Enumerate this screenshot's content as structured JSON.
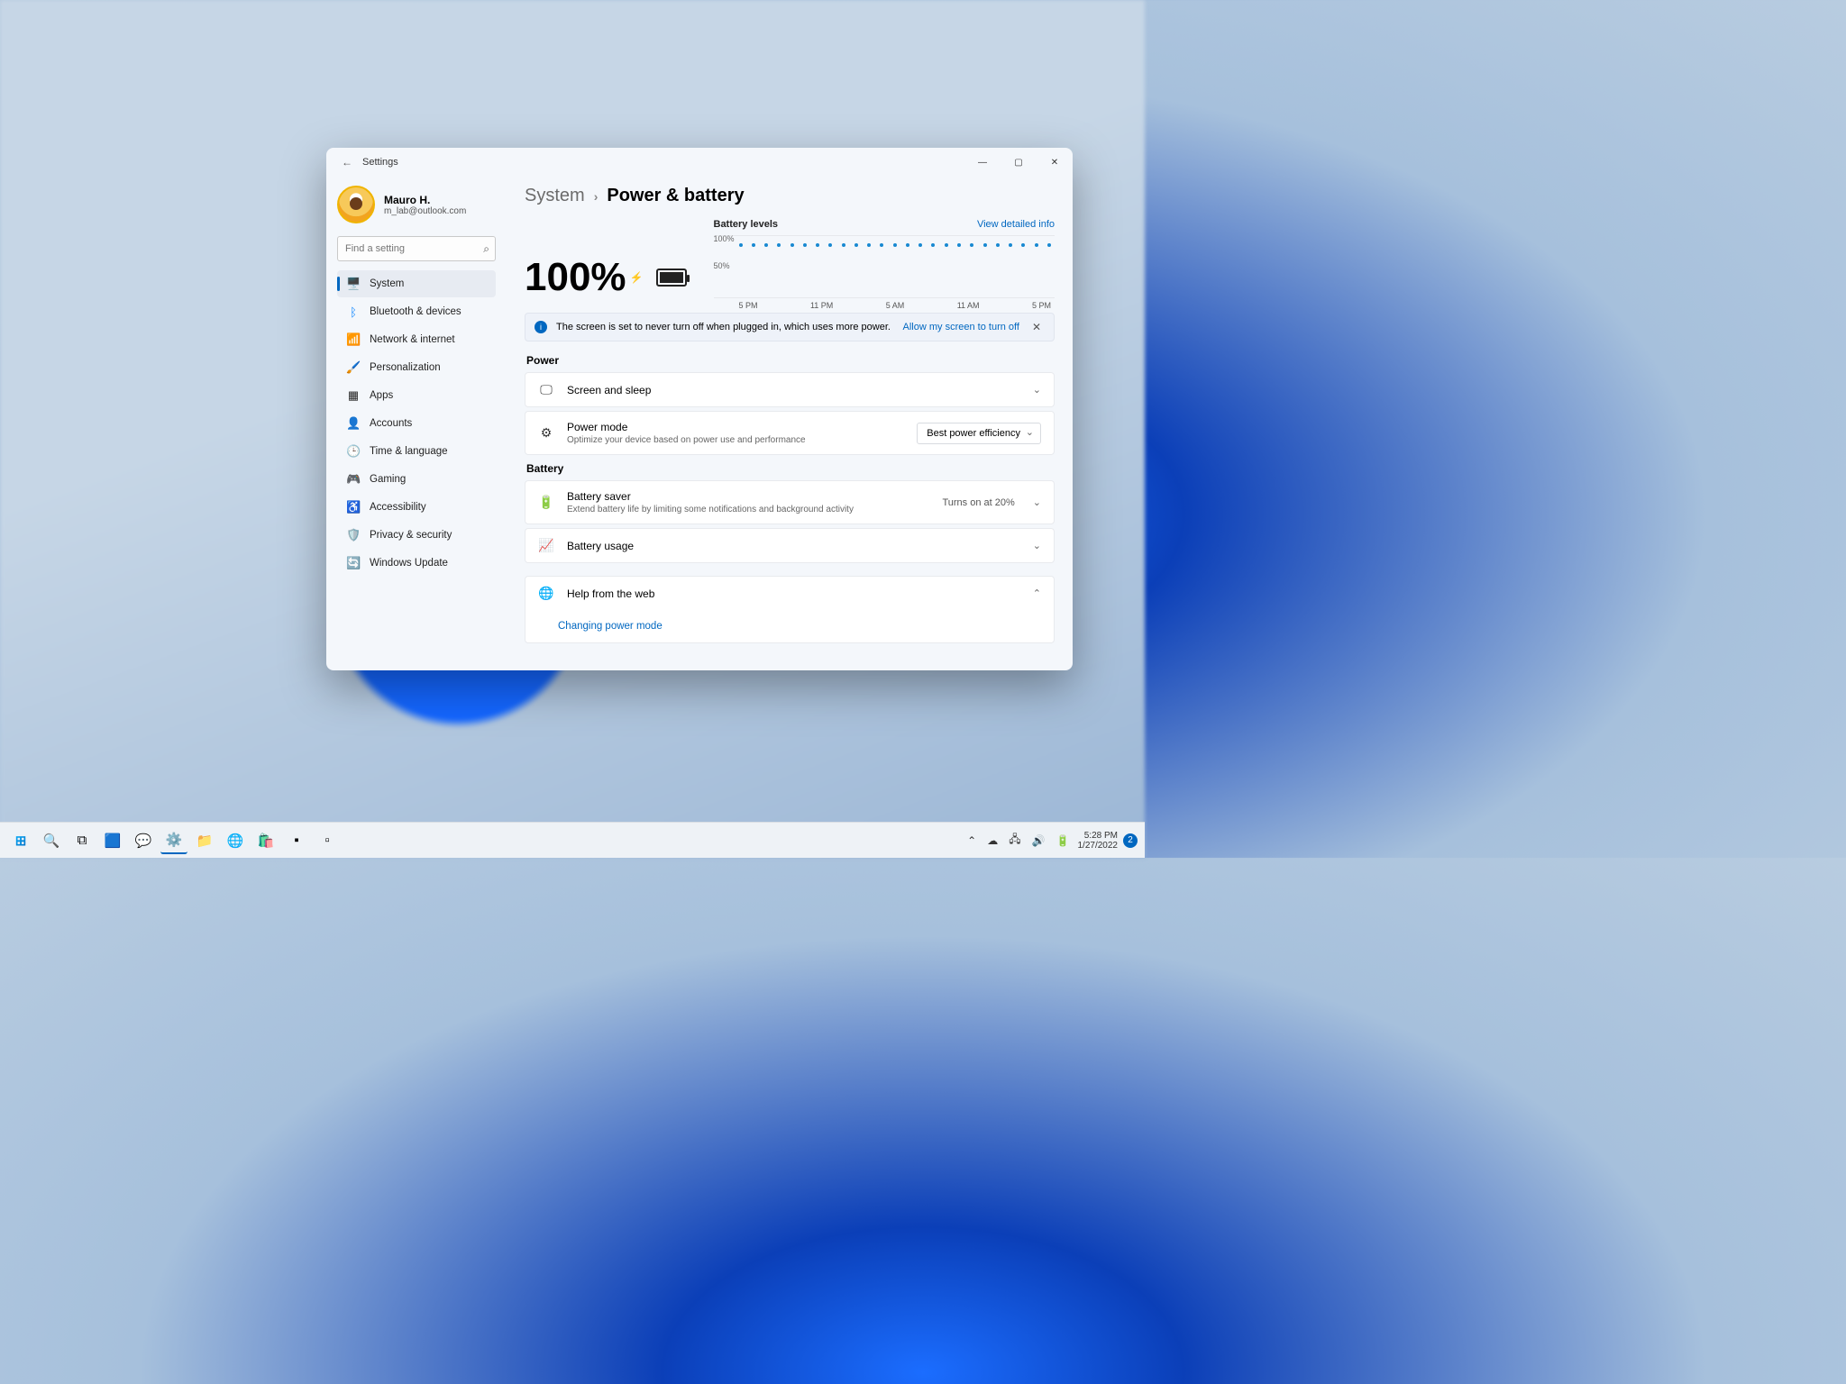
{
  "window": {
    "title": "Settings"
  },
  "profile": {
    "name": "Mauro H.",
    "email": "m_lab@outlook.com"
  },
  "search": {
    "placeholder": "Find a setting"
  },
  "nav": [
    {
      "icon": "🖥️",
      "label": "System"
    },
    {
      "icon": "ᛒ",
      "label": "Bluetooth & devices"
    },
    {
      "icon": "📶",
      "label": "Network & internet"
    },
    {
      "icon": "🖌️",
      "label": "Personalization"
    },
    {
      "icon": "▦",
      "label": "Apps"
    },
    {
      "icon": "👤",
      "label": "Accounts"
    },
    {
      "icon": "🕒",
      "label": "Time & language"
    },
    {
      "icon": "🎮",
      "label": "Gaming"
    },
    {
      "icon": "♿",
      "label": "Accessibility"
    },
    {
      "icon": "🛡️",
      "label": "Privacy & security"
    },
    {
      "icon": "🔄",
      "label": "Windows Update"
    }
  ],
  "breadcrumb": {
    "parent": "System",
    "current": "Power & battery"
  },
  "battery": {
    "percent": "100%",
    "levels_label": "Battery levels",
    "detailed_link": "View detailed info",
    "info_msg": "The screen is set to never turn off when plugged in, which uses more power.",
    "info_action": "Allow my screen to turn off"
  },
  "sections": {
    "power": "Power",
    "battery": "Battery"
  },
  "rows": {
    "screen_sleep": "Screen and sleep",
    "power_mode": {
      "title": "Power mode",
      "sub": "Optimize your device based on power use and performance",
      "value": "Best power efficiency"
    },
    "battery_saver": {
      "title": "Battery saver",
      "sub": "Extend battery life by limiting some notifications and background activity",
      "value": "Turns on at 20%"
    },
    "battery_usage": "Battery usage",
    "help": "Help from the web",
    "help_link": "Changing power mode"
  },
  "chart_data": {
    "type": "line",
    "title": "Battery levels",
    "ylabel": "%",
    "ylim": [
      0,
      100
    ],
    "x_labels": [
      "5 PM",
      "11 PM",
      "5 AM",
      "11 AM",
      "5 PM"
    ],
    "y_ticks": [
      "100%",
      "50%"
    ],
    "series": [
      {
        "name": "Battery level",
        "x": [
          "5 PM",
          "6 PM",
          "7 PM",
          "8 PM",
          "9 PM",
          "10 PM",
          "11 PM",
          "12 AM",
          "1 AM",
          "2 AM",
          "3 AM",
          "4 AM",
          "5 AM",
          "6 AM",
          "7 AM",
          "8 AM",
          "9 AM",
          "10 AM",
          "11 AM",
          "12 PM",
          "1 PM",
          "2 PM",
          "3 PM",
          "4 PM",
          "5 PM"
        ],
        "values": [
          100,
          100,
          100,
          100,
          100,
          100,
          100,
          100,
          100,
          100,
          100,
          100,
          100,
          100,
          100,
          100,
          100,
          100,
          100,
          100,
          100,
          100,
          100,
          100,
          100
        ]
      }
    ]
  },
  "taskbar": {
    "time": "5:28 PM",
    "date": "1/27/2022",
    "notif_count": "2"
  }
}
